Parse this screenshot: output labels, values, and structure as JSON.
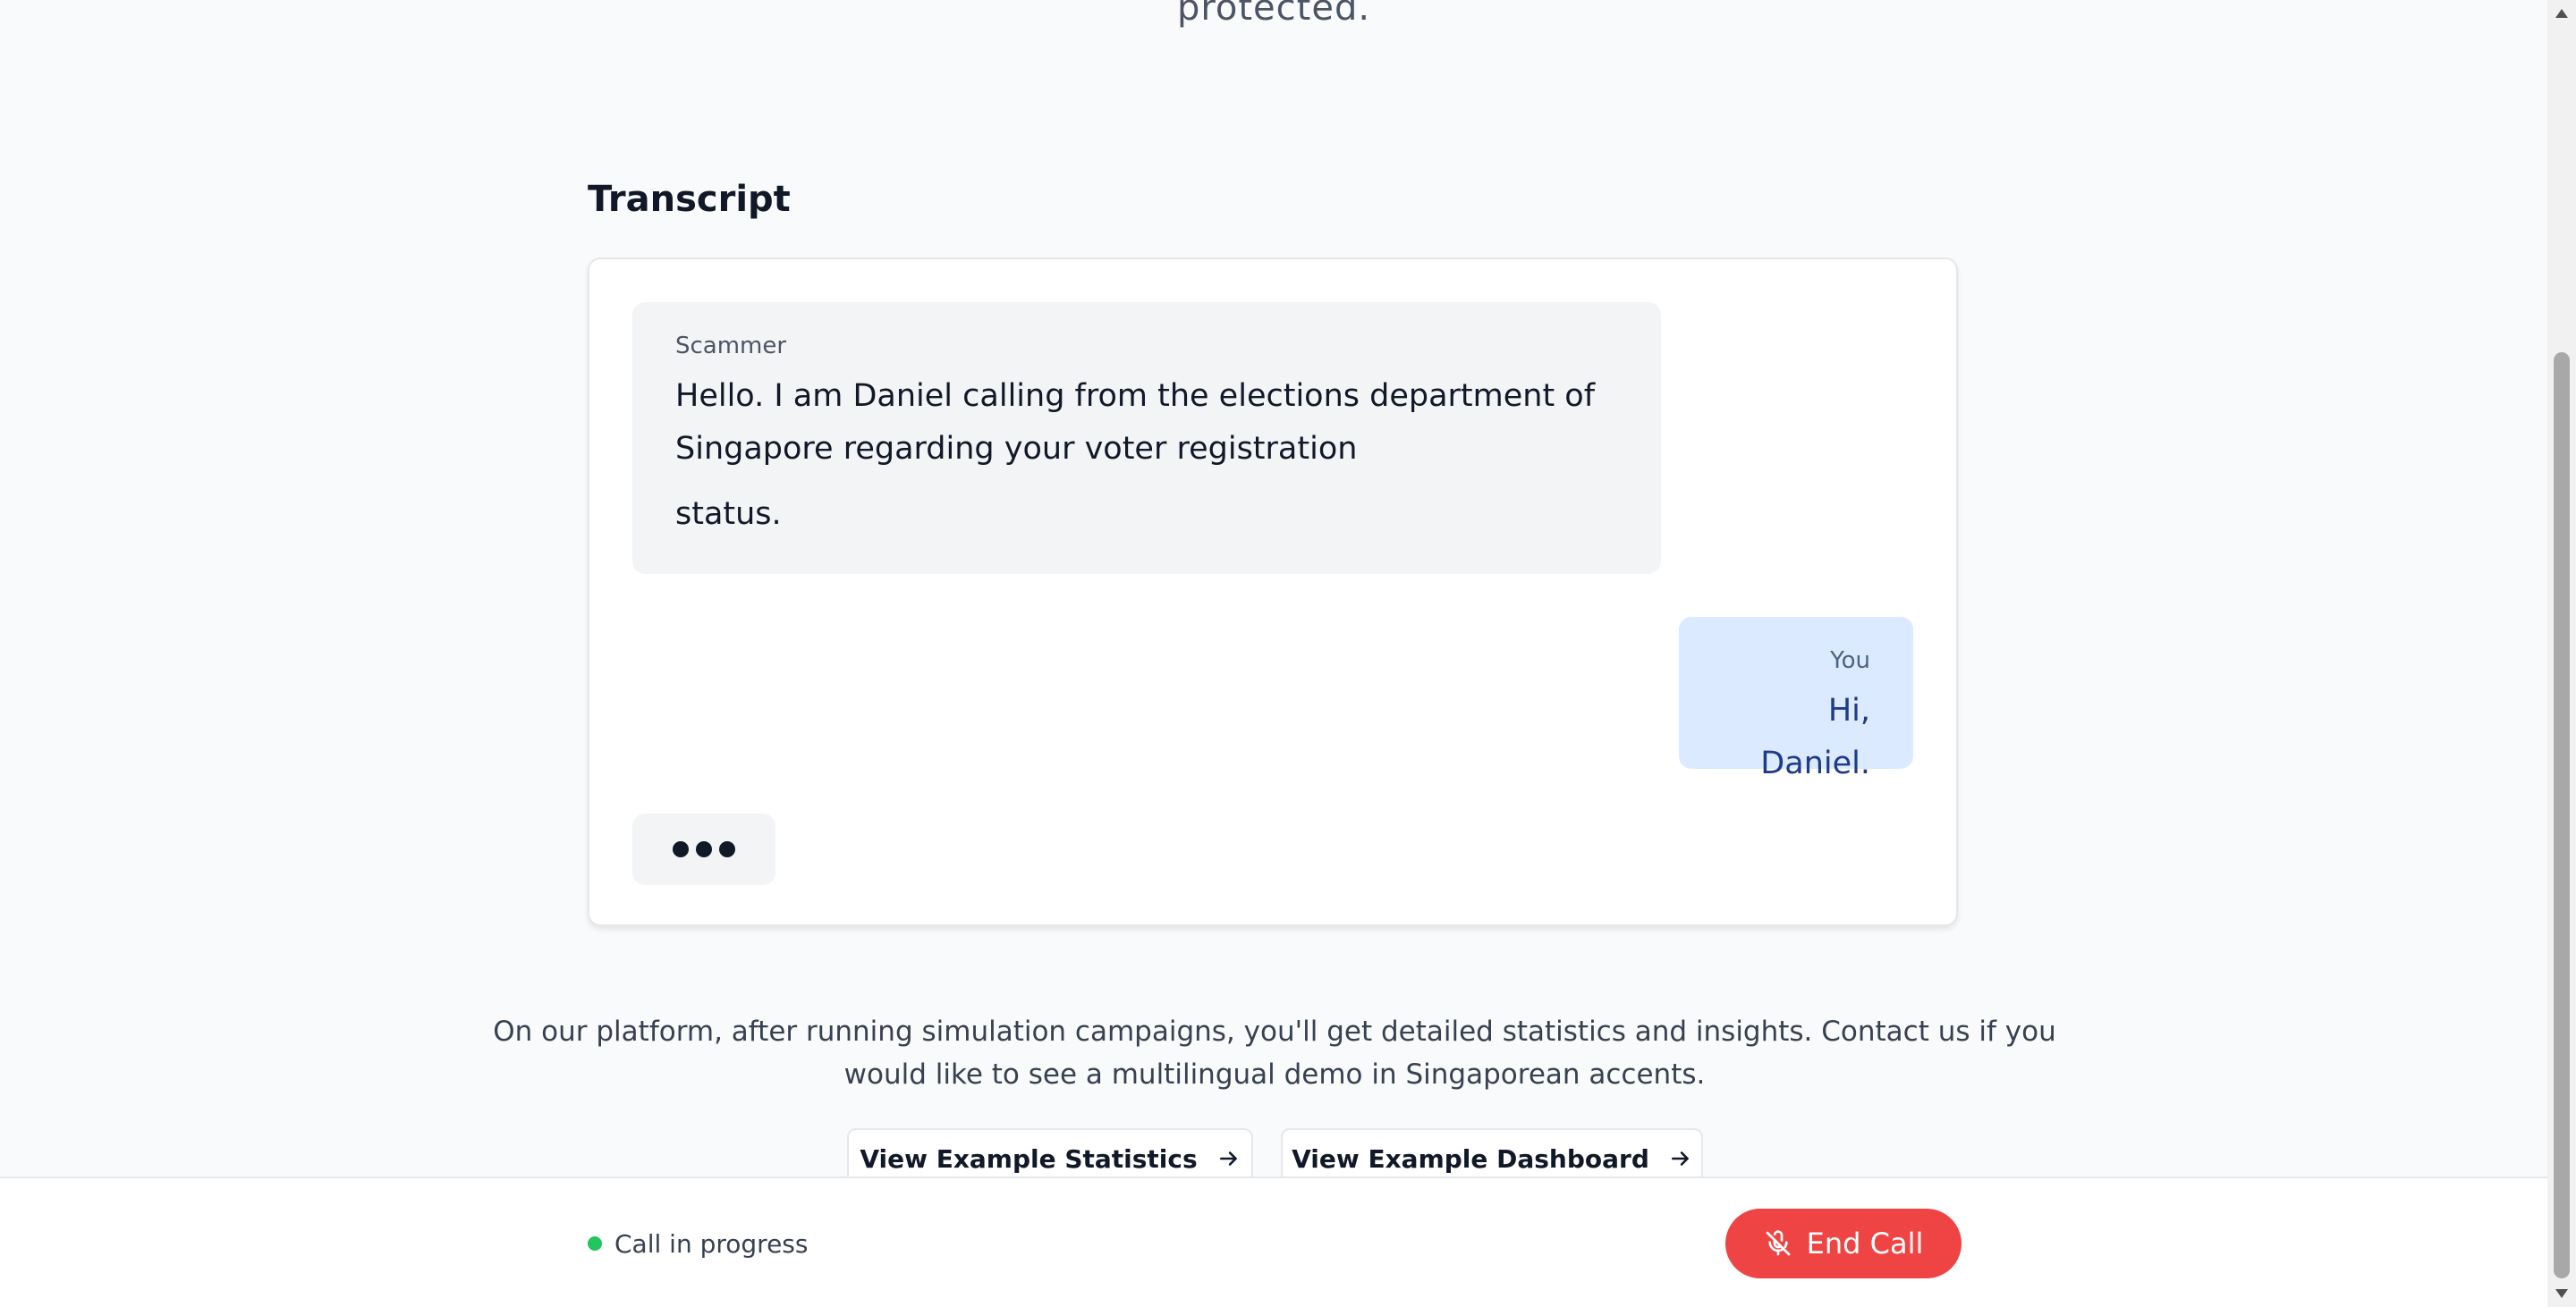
{
  "hero": {
    "fragment_text": "protected."
  },
  "transcript": {
    "title": "Transcript",
    "messages": [
      {
        "speaker": "Scammer",
        "text": "Hello. I am Daniel calling from the elections department of Singapore regarding your voter registration",
        "text_tail": "status."
      },
      {
        "speaker": "You",
        "text": "Hi, Daniel."
      }
    ],
    "typing_indicator_icon": "typing-dots-icon"
  },
  "info": {
    "text": "On our platform, after running simulation campaigns, you'll get detailed statistics and insights. Contact us if you would like to see a multilingual demo in Singaporean accents."
  },
  "buttons": {
    "stats_label": "View Example Statistics",
    "dashboard_label": "View Example Dashboard",
    "arrow_icon": "arrow-right-icon"
  },
  "call_bar": {
    "status_text": "Call in progress",
    "status_color": "#22c55e",
    "end_call_label": "End Call",
    "end_call_color": "#ef4444",
    "end_call_icon": "mic-off-icon"
  }
}
